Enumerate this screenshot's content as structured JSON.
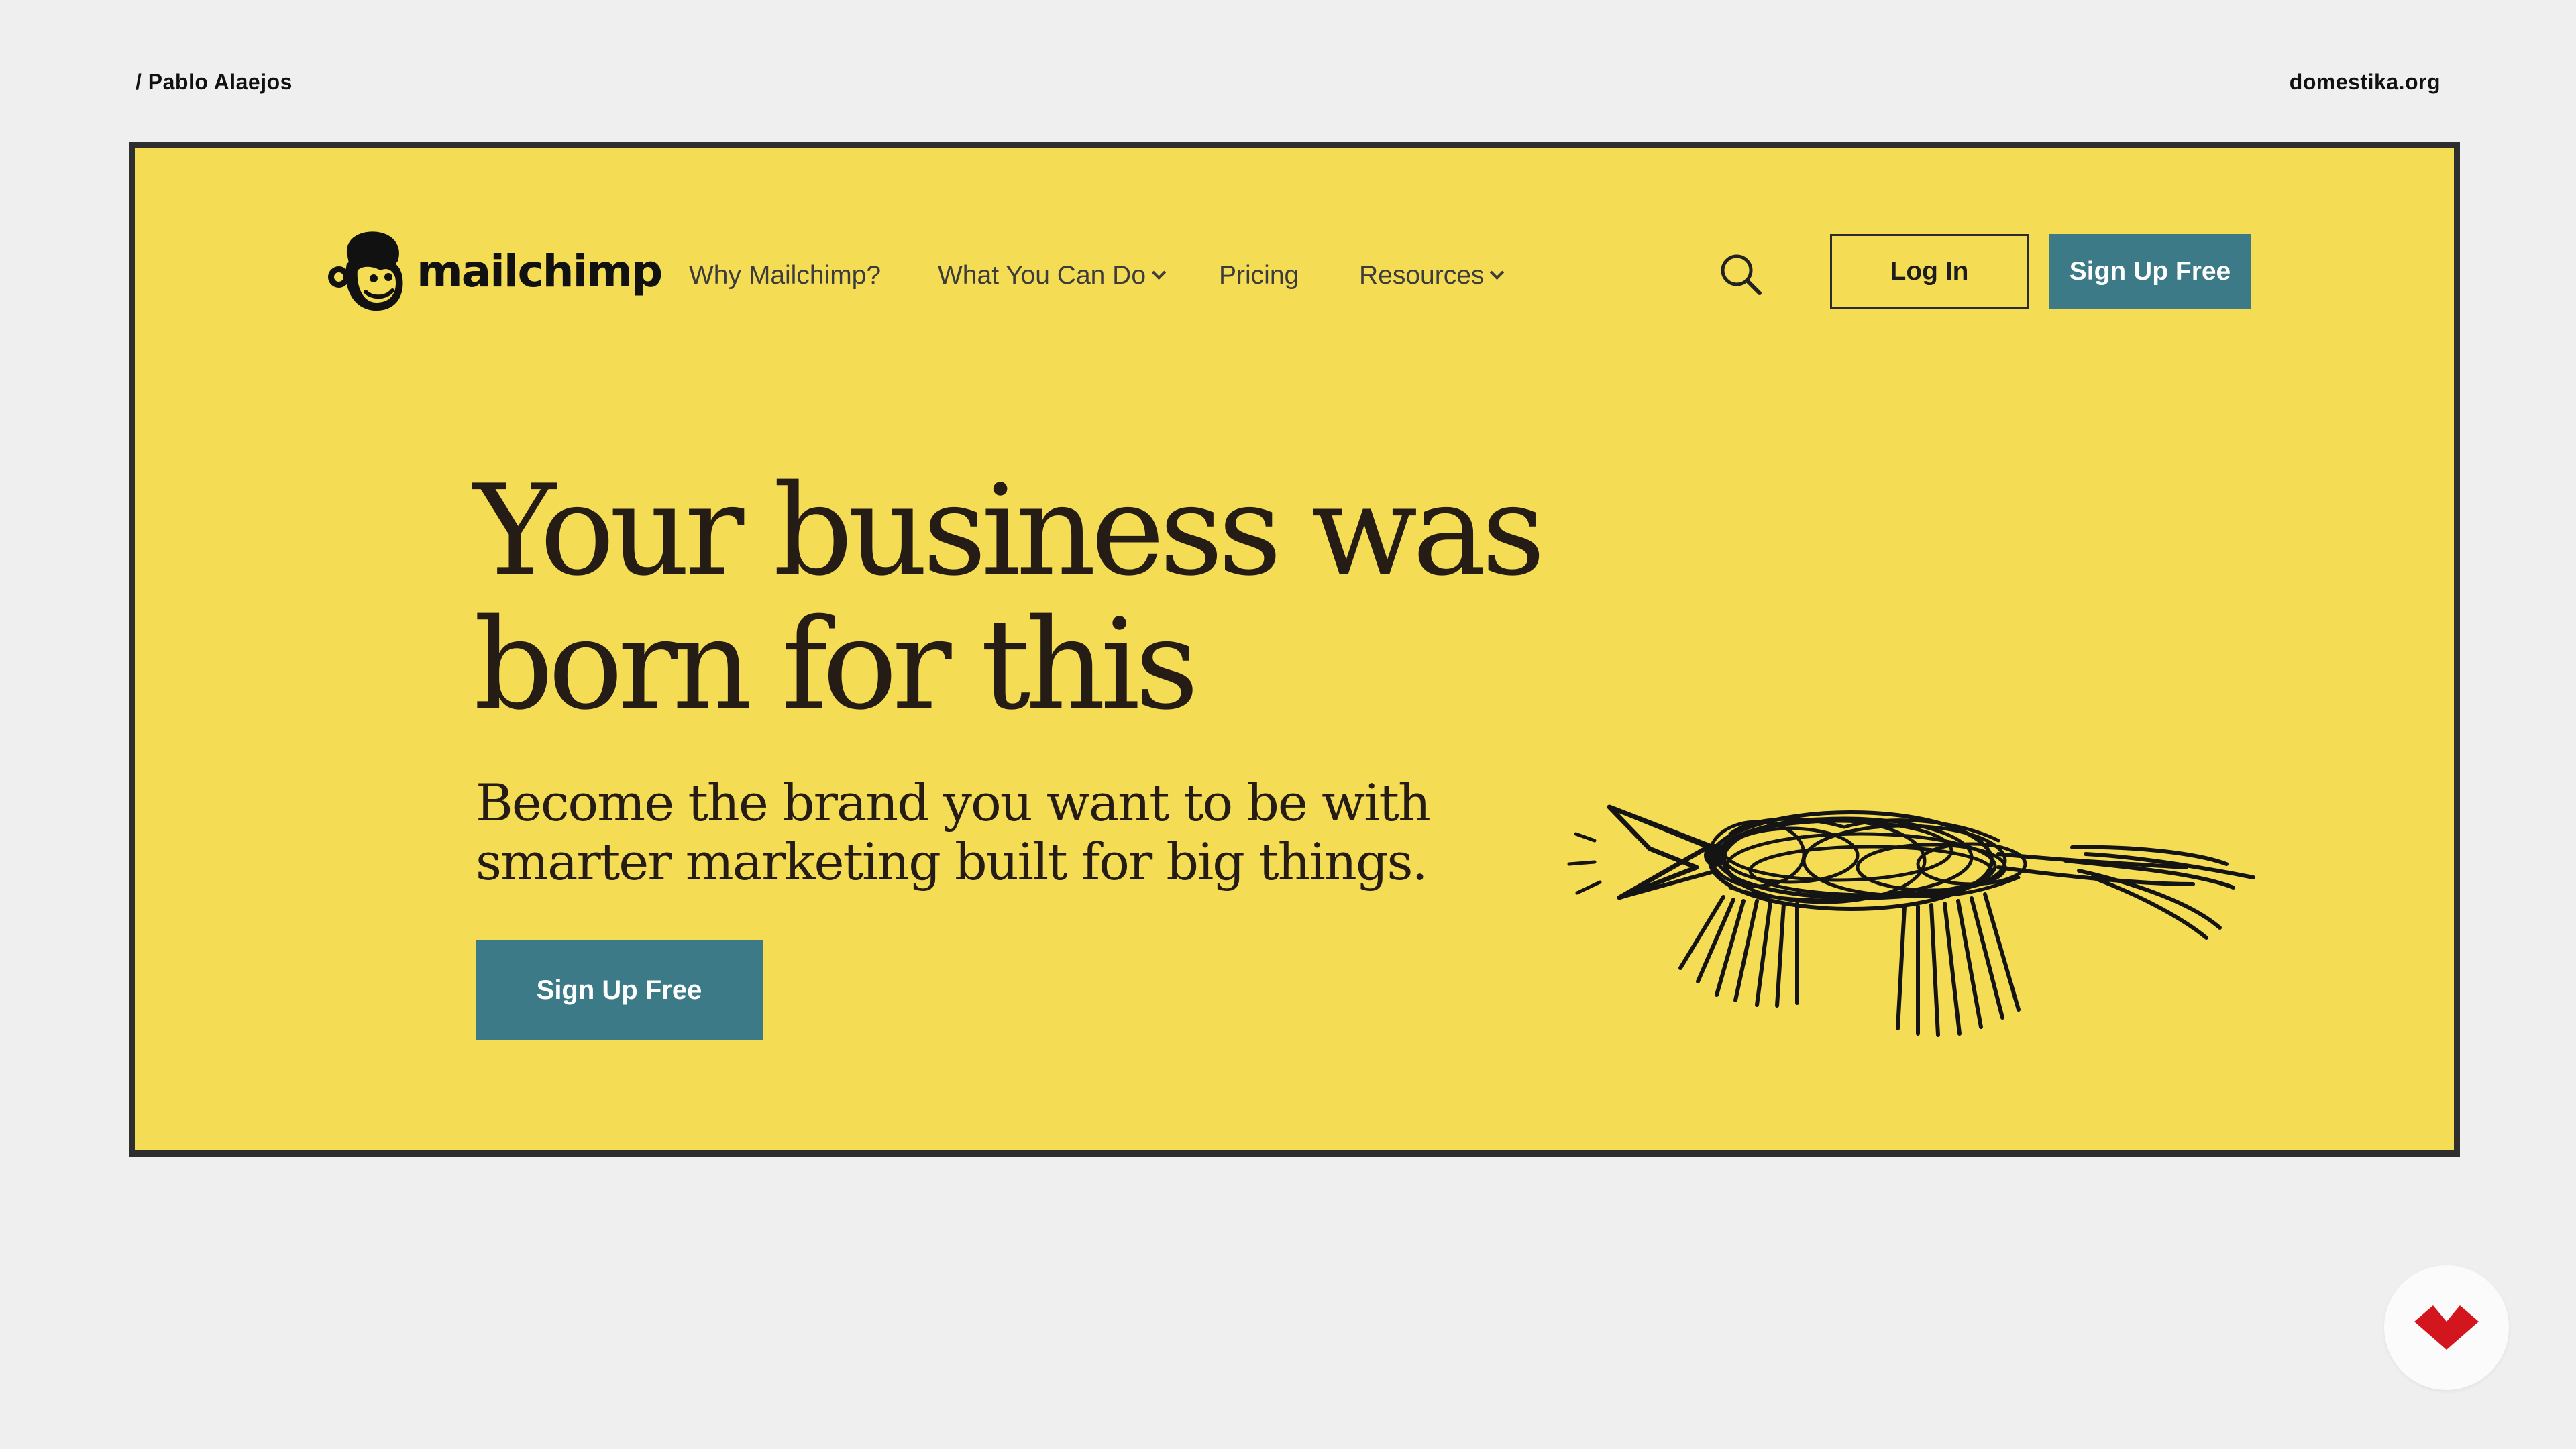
{
  "slide": {
    "author": "/ Pablo Alaejos",
    "site": "domestika.org",
    "background_color": "#efefef",
    "badge_icon": "domestika-logo-icon",
    "badge_color": "#d3161e"
  },
  "nav": {
    "logo_text": "mailchimp",
    "logo_icon": "freddie-monkey-icon",
    "items": [
      {
        "label": "Why Mailchimp?",
        "has_dropdown": false
      },
      {
        "label": "What You Can Do",
        "has_dropdown": true
      },
      {
        "label": "Pricing",
        "has_dropdown": false
      },
      {
        "label": "Resources",
        "has_dropdown": true
      }
    ],
    "search_icon": "search-icon",
    "login_label": "Log In",
    "signup_label": "Sign Up Free"
  },
  "hero": {
    "headline": "Your business was born for this",
    "subhead": "Become the brand you want to be with smarter marketing built for big things.",
    "cta_label": "Sign Up Free",
    "illustration": "scribbled-bird-illustration"
  },
  "colors": {
    "brand_yellow": "#f5dc55",
    "cta_teal": "#3b7a86",
    "text_dark": "#241c15",
    "frame_border": "#2e2e2e"
  }
}
